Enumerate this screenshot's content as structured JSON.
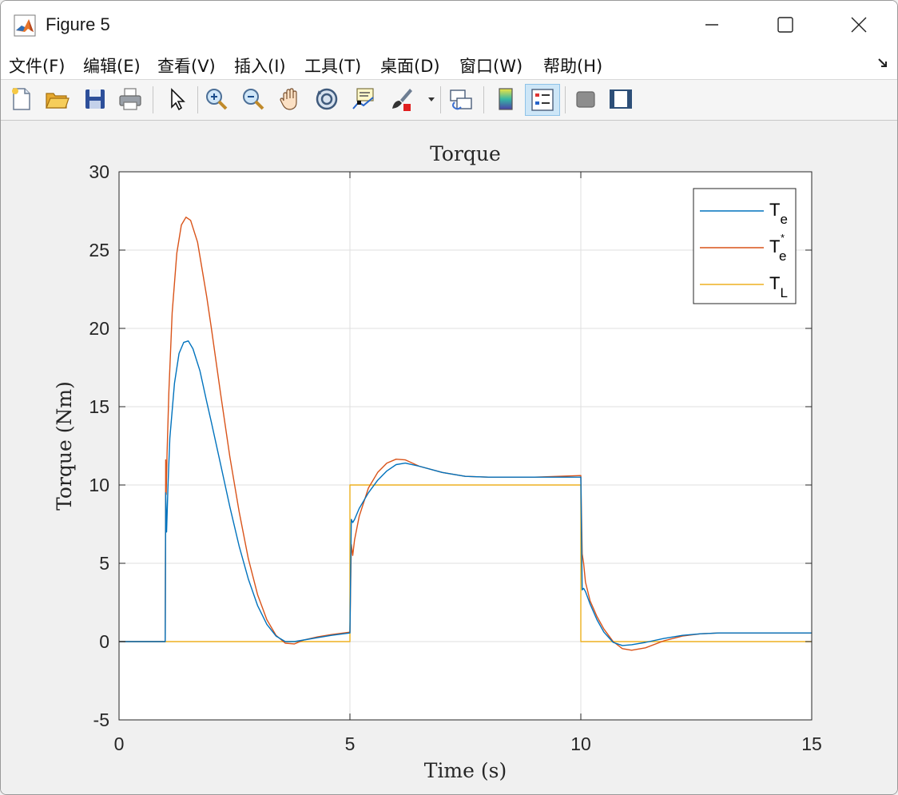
{
  "window": {
    "title": "Figure 5"
  },
  "menu": [
    {
      "label": "文件(F)",
      "key": "F"
    },
    {
      "label": "编辑(E)",
      "key": "E"
    },
    {
      "label": "查看(V)",
      "key": "V"
    },
    {
      "label": "插入(I)",
      "key": "I"
    },
    {
      "label": "工具(T)",
      "key": "T"
    },
    {
      "label": "桌面(D)",
      "key": "D"
    },
    {
      "label": "窗口(W)",
      "key": "W"
    },
    {
      "label": "帮助(H)",
      "key": "H"
    }
  ],
  "toolbar": {
    "icons": [
      "new-figure-icon",
      "open-file-icon",
      "save-icon",
      "print-icon",
      "pointer-icon",
      "zoom-in-icon",
      "zoom-out-icon",
      "pan-hand-icon",
      "rotate-3d-icon",
      "data-cursor-icon",
      "brush-icon",
      "link-plot-icon",
      "colorbar-icon",
      "legend-icon",
      "hide-plot-tools-icon",
      "show-plot-tools-icon"
    ]
  },
  "colors": {
    "te": "#0072bd",
    "te_star": "#d95319",
    "tl": "#edb120",
    "grid": "#dfdfdf",
    "axes": "#262626"
  },
  "chart_data": {
    "type": "line",
    "title": "Torque",
    "xlabel": "Time (s)",
    "ylabel": "Torque (Nm)",
    "xlim": [
      0,
      15
    ],
    "ylim": [
      -5,
      30
    ],
    "xticks": [
      0,
      5,
      10,
      15
    ],
    "yticks": [
      -5,
      0,
      5,
      10,
      15,
      20,
      25,
      30
    ],
    "grid": true,
    "legend_position": "top-right",
    "legend": [
      {
        "base": "T",
        "sub": "e",
        "sup": ""
      },
      {
        "base": "T",
        "sub": "e",
        "sup": "*"
      },
      {
        "base": "T",
        "sub": "L",
        "sup": ""
      }
    ],
    "series": [
      {
        "key": "te",
        "x": [
          0,
          0.98,
          1.0,
          1.01,
          1.03,
          1.06,
          1.1,
          1.2,
          1.3,
          1.4,
          1.5,
          1.6,
          1.75,
          1.9,
          2.0,
          2.2,
          2.4,
          2.6,
          2.8,
          3.0,
          3.2,
          3.4,
          3.6,
          3.8,
          4.0,
          4.3,
          4.6,
          5.0,
          5.0,
          5.03,
          5.06,
          5.1,
          5.2,
          5.4,
          5.6,
          5.8,
          6.0,
          6.2,
          6.5,
          7.0,
          7.5,
          8.0,
          8.5,
          9.0,
          9.5,
          10.0,
          10.0,
          10.03,
          10.06,
          10.1,
          10.2,
          10.35,
          10.5,
          10.7,
          10.9,
          11.1,
          11.4,
          11.8,
          12.2,
          12.6,
          13.0,
          14.0,
          15.0
        ],
        "y": [
          0,
          0,
          0,
          9.5,
          7.0,
          10.0,
          13.0,
          16.5,
          18.4,
          19.1,
          19.2,
          18.7,
          17.3,
          15.3,
          14.0,
          11.3,
          8.6,
          6.1,
          4.0,
          2.3,
          1.1,
          0.35,
          0.0,
          0.0,
          0.1,
          0.25,
          0.4,
          0.55,
          0.55,
          7.8,
          7.6,
          7.8,
          8.5,
          9.5,
          10.3,
          10.9,
          11.3,
          11.4,
          11.2,
          10.8,
          10.55,
          10.5,
          10.5,
          10.5,
          10.5,
          10.5,
          10.5,
          3.3,
          3.4,
          3.2,
          2.4,
          1.4,
          0.6,
          -0.05,
          -0.25,
          -0.2,
          -0.05,
          0.2,
          0.4,
          0.5,
          0.55,
          0.55,
          0.55
        ]
      },
      {
        "key": "te_star",
        "x": [
          0,
          0.98,
          1.0,
          1.01,
          1.02,
          1.04,
          1.08,
          1.15,
          1.25,
          1.35,
          1.45,
          1.55,
          1.7,
          1.9,
          2.0,
          2.2,
          2.4,
          2.6,
          2.8,
          3.0,
          3.2,
          3.4,
          3.6,
          3.8,
          4.0,
          4.3,
          4.6,
          5.0,
          5.0,
          5.03,
          5.06,
          5.1,
          5.2,
          5.4,
          5.6,
          5.8,
          6.0,
          6.2,
          6.5,
          7.0,
          7.5,
          8.0,
          8.5,
          9.0,
          9.5,
          10.0,
          10.0,
          10.03,
          10.06,
          10.1,
          10.2,
          10.35,
          10.5,
          10.7,
          10.9,
          11.1,
          11.4,
          11.8,
          12.2,
          12.6,
          13.0,
          14.0,
          15.0
        ],
        "y": [
          0,
          0,
          0,
          11.6,
          9.4,
          12.0,
          16.0,
          21.0,
          24.8,
          26.6,
          27.1,
          26.9,
          25.5,
          22.0,
          20.0,
          15.8,
          11.8,
          8.3,
          5.3,
          3.0,
          1.4,
          0.4,
          -0.1,
          -0.15,
          0.1,
          0.3,
          0.45,
          0.6,
          0.6,
          6.2,
          5.5,
          6.5,
          8.0,
          9.8,
          10.8,
          11.4,
          11.65,
          11.6,
          11.2,
          10.8,
          10.55,
          10.5,
          10.5,
          10.5,
          10.55,
          10.6,
          10.6,
          5.6,
          5.0,
          3.8,
          2.6,
          1.6,
          0.8,
          0.0,
          -0.45,
          -0.55,
          -0.4,
          0.05,
          0.35,
          0.5,
          0.55,
          0.55,
          0.55
        ]
      },
      {
        "key": "tl",
        "x": [
          0,
          5.0,
          5.0,
          10.0,
          10.0,
          15.0
        ],
        "y": [
          0,
          0,
          10,
          10,
          0,
          0
        ]
      }
    ]
  }
}
